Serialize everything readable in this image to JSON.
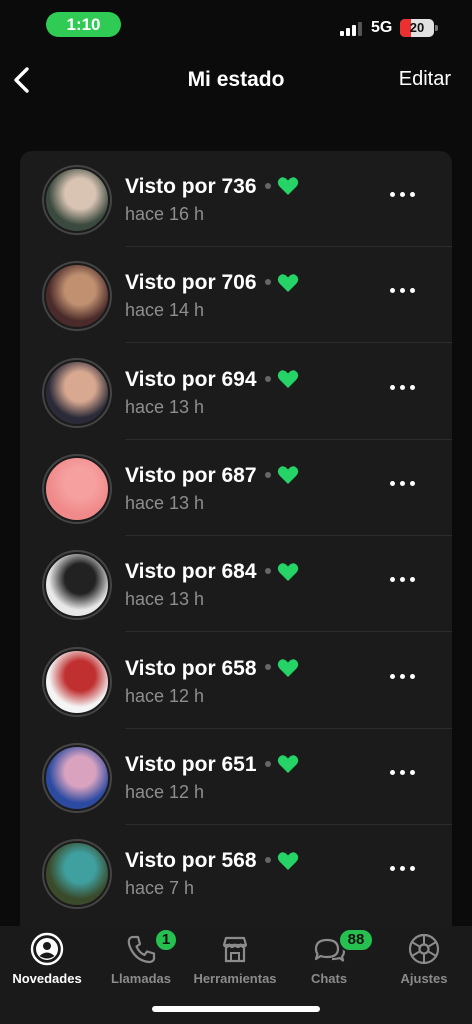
{
  "status_bar": {
    "time": "1:10",
    "network": "5G",
    "battery": "20",
    "accent": "#2fcb55"
  },
  "nav": {
    "back_icon": "chevron-left-icon",
    "title": "Mi estado",
    "edit_label": "Editar"
  },
  "statuses": [
    {
      "seen": "Visto por 736",
      "ago": "hace 16 h",
      "avatar_caption": "",
      "avatar_colors": [
        "#3b4a3e",
        "#d9c4b4"
      ]
    },
    {
      "seen": "Visto por 706",
      "ago": "hace 14 h",
      "avatar_caption": "",
      "avatar_colors": [
        "#4a2a2a",
        "#c09070"
      ]
    },
    {
      "seen": "Visto por 694",
      "ago": "hace 13 h",
      "avatar_caption": "",
      "avatar_colors": [
        "#2a2a38",
        "#d8a890"
      ]
    },
    {
      "seen": "Visto por 687",
      "ago": "hace 13 h",
      "avatar_caption": "",
      "avatar_colors": [
        "#f08a8a",
        "#f6a0a0"
      ]
    },
    {
      "seen": "Visto por 684",
      "ago": "hace 13 h",
      "avatar_caption": "",
      "avatar_colors": [
        "#e8e8e8",
        "#222222"
      ]
    },
    {
      "seen": "Visto por 658",
      "ago": "hace 12 h",
      "avatar_caption": "",
      "avatar_colors": [
        "#f4f4f4",
        "#c03030"
      ]
    },
    {
      "seen": "Visto por 651",
      "ago": "hace 12 h",
      "avatar_caption": "",
      "avatar_colors": [
        "#2b4aa0",
        "#d9a3c0"
      ]
    },
    {
      "seen": "Visto por 568",
      "ago": "hace 7 h",
      "avatar_caption": "",
      "avatar_colors": [
        "#3a4a2a",
        "#40a0a0"
      ]
    }
  ],
  "heart_color": "#25d366",
  "tabs": [
    {
      "label": "Novedades",
      "icon": "status-icon",
      "active": true,
      "badge": ""
    },
    {
      "label": "Llamadas",
      "icon": "phone-icon",
      "active": false,
      "badge": "1"
    },
    {
      "label": "Herramientas",
      "icon": "store-icon",
      "active": false,
      "badge": ""
    },
    {
      "label": "Chats",
      "icon": "chat-bubbles-icon",
      "active": false,
      "badge": "88"
    },
    {
      "label": "Ajustes",
      "icon": "gear-icon",
      "active": false,
      "badge": ""
    }
  ]
}
